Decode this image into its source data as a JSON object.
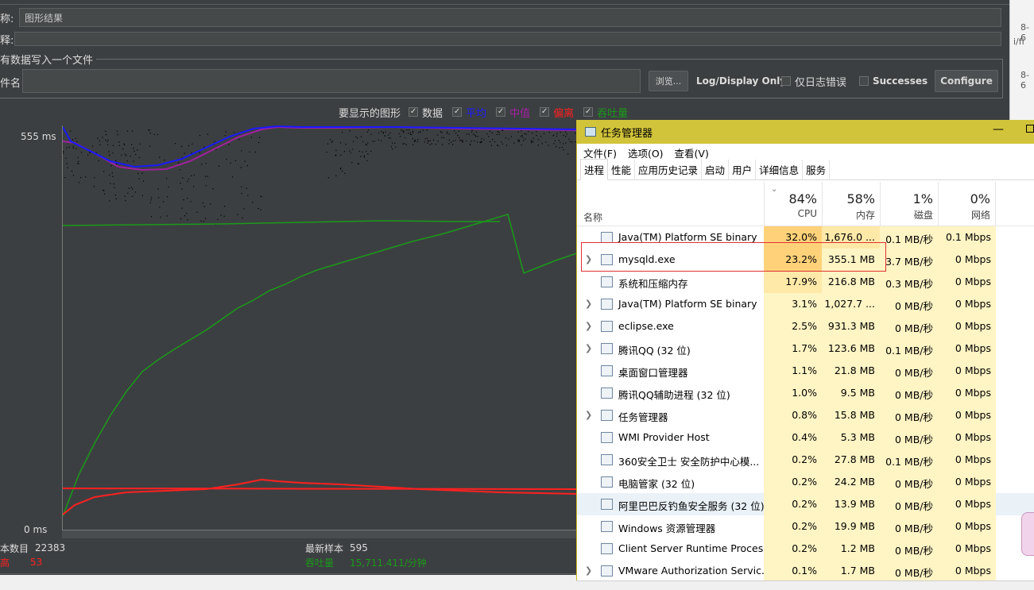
{
  "jmeter": {
    "name_label": "称:",
    "name_value": "图形结果",
    "comment_label": "释:",
    "file_section_title": "有数据写入一个文件",
    "filename_label": "件名",
    "browse_label": "浏览...",
    "log_display_label": "Log/Display Only:",
    "errors_only_label": "仅日志错误",
    "successes_label": "Successes",
    "configure_label": "Configure",
    "graphs_to_show_label": "要显示的图形",
    "legend": [
      {
        "label": "数据",
        "color": "#d6d6d6"
      },
      {
        "label": "平均",
        "color": "#1a1aff"
      },
      {
        "label": "中值",
        "color": "#a020a0"
      },
      {
        "label": "偏离",
        "color": "#ff2020"
      },
      {
        "label": "吞吐量",
        "color": "#1a9a1a"
      }
    ],
    "y_max_label": "555 ms",
    "y_min_label": "0 ms",
    "sample_count_label": "本数目",
    "sample_count_value": "22383",
    "latest_sample_label": "最新样本",
    "latest_sample_value": "595",
    "deviation_label": "高",
    "deviation_value": "53",
    "throughput_label": "吞吐量",
    "throughput_value": "15,711.411/分钟"
  },
  "side_strip": [
    "8-6",
    "i/fi",
    "8-6"
  ],
  "task_manager": {
    "title": "任务管理器",
    "menu": [
      "文件(F)",
      "选项(O)",
      "查看(V)"
    ],
    "tabs": [
      "进程",
      "性能",
      "应用历史记录",
      "启动",
      "用户",
      "详细信息",
      "服务"
    ],
    "columns": {
      "name": "名称",
      "cpu": {
        "pct": "84%",
        "label": "CPU"
      },
      "mem": {
        "pct": "58%",
        "label": "内存"
      },
      "disk": {
        "pct": "1%",
        "label": "磁盘"
      },
      "net": {
        "pct": "0%",
        "label": "网络"
      }
    },
    "colors": {
      "cpu_high": "#ffd27a",
      "cpu_mid": "#ffe9a8",
      "col_light": "#fff4c4",
      "highlight_row": "#eaf2f8"
    },
    "rows": [
      {
        "name": "Java(TM) Platform SE binary",
        "cpu": "32.0%",
        "mem": "1,676.0 ...",
        "disk": "0.1 MB/秒",
        "net": "0.1 Mbps",
        "expandable": false
      },
      {
        "name": "mysqld.exe",
        "cpu": "23.2%",
        "mem": "355.1 MB",
        "disk": "3.7 MB/秒",
        "net": "0 Mbps",
        "expandable": true
      },
      {
        "name": "系统和压缩内存",
        "cpu": "17.9%",
        "mem": "216.8 MB",
        "disk": "0.3 MB/秒",
        "net": "0 Mbps",
        "expandable": false
      },
      {
        "name": "Java(TM) Platform SE binary",
        "cpu": "3.1%",
        "mem": "1,027.7 ...",
        "disk": "0 MB/秒",
        "net": "0 Mbps",
        "expandable": true
      },
      {
        "name": "eclipse.exe",
        "cpu": "2.5%",
        "mem": "931.3 MB",
        "disk": "0 MB/秒",
        "net": "0 Mbps",
        "expandable": true
      },
      {
        "name": "腾讯QQ (32 位)",
        "cpu": "1.7%",
        "mem": "123.6 MB",
        "disk": "0.1 MB/秒",
        "net": "0 Mbps",
        "expandable": true
      },
      {
        "name": "桌面窗口管理器",
        "cpu": "1.1%",
        "mem": "21.8 MB",
        "disk": "0 MB/秒",
        "net": "0 Mbps",
        "expandable": false
      },
      {
        "name": "腾讯QQ辅助进程 (32 位)",
        "cpu": "1.0%",
        "mem": "9.5 MB",
        "disk": "0 MB/秒",
        "net": "0 Mbps",
        "expandable": false
      },
      {
        "name": "任务管理器",
        "cpu": "0.8%",
        "mem": "15.8 MB",
        "disk": "0 MB/秒",
        "net": "0 Mbps",
        "expandable": true
      },
      {
        "name": "WMI Provider Host",
        "cpu": "0.4%",
        "mem": "5.3 MB",
        "disk": "0 MB/秒",
        "net": "0 Mbps",
        "expandable": false
      },
      {
        "name": "360安全卫士 安全防护中心模...",
        "cpu": "0.2%",
        "mem": "27.8 MB",
        "disk": "0.1 MB/秒",
        "net": "0 Mbps",
        "expandable": false
      },
      {
        "name": "电脑管家 (32 位)",
        "cpu": "0.2%",
        "mem": "24.2 MB",
        "disk": "0 MB/秒",
        "net": "0 Mbps",
        "expandable": false
      },
      {
        "name": "阿里巴巴反钓鱼安全服务 (32 位)",
        "cpu": "0.2%",
        "mem": "13.9 MB",
        "disk": "0 MB/秒",
        "net": "0 Mbps",
        "expandable": false,
        "highlight": true
      },
      {
        "name": "Windows 资源管理器",
        "cpu": "0.2%",
        "mem": "19.9 MB",
        "disk": "0 MB/秒",
        "net": "0 Mbps",
        "expandable": false
      },
      {
        "name": "Client Server Runtime Process",
        "cpu": "0.2%",
        "mem": "1.2 MB",
        "disk": "0 MB/秒",
        "net": "0 Mbps",
        "expandable": false
      },
      {
        "name": "VMware Authorization Servic...",
        "cpu": "0.1%",
        "mem": "1.7 MB",
        "disk": "0 MB/秒",
        "net": "0 Mbps",
        "expandable": true
      }
    ]
  }
}
